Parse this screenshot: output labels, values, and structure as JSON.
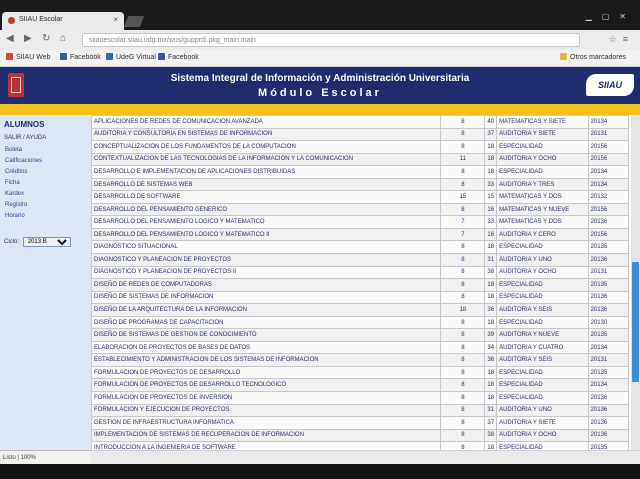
{
  "browser": {
    "tab_title": "SIIAU Escolar",
    "tab_close": "×",
    "url": "siiauescolar.siiau.udg.mx/wus/gupprdi.pkg_main.main",
    "bookmarks": [
      {
        "label": "SIIAU Web",
        "color": "#d04a2b"
      },
      {
        "label": "Facebook",
        "color": "#3b5998"
      },
      {
        "label": "UdeG Virtual",
        "color": "#2d6bbf"
      },
      {
        "label": "Facebook",
        "color": "#3b5998"
      }
    ],
    "other_bookmarks": "Otros marcadores"
  },
  "header": {
    "title": "Sistema Integral de Información y Administración Universitaria",
    "subtitle": "Módulo Escolar",
    "logo_text": "SIIAU",
    "brand_color": "#1f2d6e",
    "accent_color": "#f2c11d"
  },
  "sidebar": {
    "title": "ALUMNOS",
    "subtitle": "SALIR / AYUDA",
    "items": [
      "Boleta",
      "Calificaciones",
      "Créditos",
      "Ficha",
      "Kardex",
      "Registro",
      "Horario"
    ],
    "select_label": "Ciclo:",
    "select_value": "2013 B"
  },
  "status_text": "Listo | 100%",
  "table": {
    "rows": [
      [
        "APLICACIONES DE REDES DE COMUNICACION AVANZADA",
        "8",
        "40",
        "MATEMATICAS Y SIETE",
        "20134"
      ],
      [
        "AUDITORIA Y CONSULTORIA EN SISTEMAS DE INFORMACION",
        "8",
        "37",
        "AUDITORIA Y SIETE",
        "20131"
      ],
      [
        "CONCEPTUALIZACION DE LOS FUNDAMENTOS DE LA COMPUTACION",
        "8",
        "18",
        "ESPECIALIDAD",
        "20156"
      ],
      [
        "CONTEXTUALIZACION DE LAS TECNOLOGIAS DE LA INFORMACION Y LA COMUNICACION",
        "11",
        "18",
        "AUDITORIA Y OCHO",
        "20156"
      ],
      [
        "DESARROLLO E IMPLEMENTACION DE APLICACIONES DISTRIBUIDAS",
        "8",
        "18",
        "ESPECIALIDAD",
        "20134"
      ],
      [
        "DESARROLLO DE SISTEMAS WEB",
        "8",
        "33",
        "AUDITORIA Y TRES",
        "20134"
      ],
      [
        "DESARROLLO DE SOFTWARE",
        "15",
        "15",
        "MATEMATICAS Y DOS",
        "20132"
      ],
      [
        "DESARROLLO DEL PENSAMIENTO GENERICO",
        "8",
        "16",
        "MATEMATICAS Y NUEVE",
        "20156"
      ],
      [
        "DESARROLLO DEL PENSAMIENTO LOGICO Y MATEMATICO",
        "7",
        "33",
        "MATEMATICAS Y DOS",
        "20136"
      ],
      [
        "DESARROLLO DEL PENSAMIENTO LOGICO Y MATEMATICO II",
        "7",
        "16",
        "AUDITORIA Y CERO",
        "20156"
      ],
      [
        "DIAGNOSTICO SITUACIONAL",
        "8",
        "18",
        "ESPECIALIDAD",
        "20135"
      ],
      [
        "DIAGNOSTICO Y PLANEACION DE PROYECTOS",
        "8",
        "31",
        "AUDITORIA Y UNO",
        "20136"
      ],
      [
        "DIAGNOSTICO Y PLANEACION DE PROYECTOS II",
        "8",
        "38",
        "AUDITORIA Y OCHO",
        "20131"
      ],
      [
        "DISEÑO DE REDES DE COMPUTADORAS",
        "8",
        "18",
        "ESPECIALIDAD",
        "20135"
      ],
      [
        "DISEÑO DE SISTEMAS DE INFORMACION",
        "8",
        "18",
        "ESPECIALIDAD",
        "20136"
      ],
      [
        "DISEÑO DE LA ARQUITECTURA DE LA INFORMACION",
        "18",
        "36",
        "AUDITORIA Y SEIS",
        "20136"
      ],
      [
        "DISEÑO DE PROGRAMAS DE CAPACITACION",
        "8",
        "18",
        "ESPECIALIDAD",
        "20130"
      ],
      [
        "DISEÑO DE SISTEMAS DE GESTION DE CONOCIMIENTO",
        "8",
        "39",
        "AUDITORIA Y NUEVE",
        "20135"
      ],
      [
        "ELABORACION DE PROYECTOS DE BASES DE DATOS",
        "8",
        "34",
        "AUDITORIA Y CUATRO",
        "20134"
      ],
      [
        "ESTABLECIMIENTO Y ADMINISTRACION DE LOS SISTEMAS DE INFORMACION",
        "8",
        "36",
        "AUDITORIA Y SEIS",
        "20131"
      ],
      [
        "FORMULACION DE PROYECTOS DE DESARROLLO",
        "8",
        "18",
        "ESPECIALIDAD",
        "20135"
      ],
      [
        "FORMULACION DE PROYECTOS DE DESARROLLO TECNOLOGICO",
        "8",
        "18",
        "ESPECIALIDAD",
        "20134"
      ],
      [
        "FORMULACION DE PROYECTOS DE INVERSION",
        "8",
        "18",
        "ESPECIALIDAD",
        "20136"
      ],
      [
        "FORMULACION Y EJECUCION DE PROYECTOS",
        "8",
        "31",
        "AUDITORIA Y UNO",
        "20136"
      ],
      [
        "GESTION DE INFRAESTRUCTURA INFORMATICA",
        "8",
        "37",
        "AUDITORIA Y SIETE",
        "20136"
      ],
      [
        "IMPLEMENTACION DE SISTEMAS DE RECUPERACION DE INFORMACION",
        "8",
        "38",
        "AUDITORIA Y OCHO",
        "20136"
      ],
      [
        "INTRODUCCION A LA INGENIERIA DE SOFTWARE",
        "8",
        "18",
        "ESPECIALIDAD",
        "20135"
      ]
    ]
  }
}
